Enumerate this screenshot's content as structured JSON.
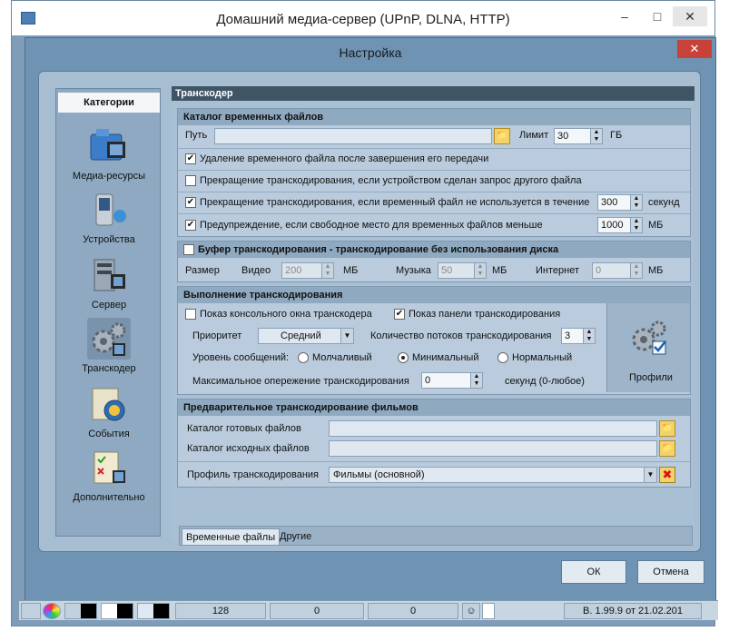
{
  "app": {
    "title": "Домашний медиа-сервер (UPnP, DLNA, HTTP)"
  },
  "dialog": {
    "title": "Настройка"
  },
  "sidebar": {
    "header": "Категории",
    "items": [
      {
        "label": "Медиа-ресурсы",
        "icon": "film-folder-icon"
      },
      {
        "label": "Устройства",
        "icon": "device-icon"
      },
      {
        "label": "Сервер",
        "icon": "server-icon"
      },
      {
        "label": "Транскодер",
        "icon": "gears-icon"
      },
      {
        "label": "События",
        "icon": "events-icon"
      },
      {
        "label": "Дополнительно",
        "icon": "checklist-icon"
      }
    ],
    "selected": "Транскодер"
  },
  "content": {
    "header": "Транскодер",
    "temp_catalog": {
      "title": "Каталог временных файлов",
      "path_label": "Путь",
      "path_value": "",
      "limit_label": "Лимит",
      "limit_value": "30",
      "limit_unit": "ГБ",
      "opt1": {
        "label": "Удаление временного файла после завершения его передачи",
        "checked": true
      },
      "opt2": {
        "label": "Прекращение транскодирования, если устройством сделан запрос другого файла",
        "checked": false
      },
      "opt3": {
        "label": "Прекращение транскодирования, если временный файл не используется в течение",
        "checked": true,
        "value": "300",
        "unit": "секунд"
      },
      "opt4": {
        "label": "Предупреждение, если свободное место для временных файлов меньше",
        "checked": true,
        "value": "1000",
        "unit": "МБ"
      }
    },
    "buffer": {
      "title": "Буфер транскодирования - транскодирование без использования диска",
      "checked": false,
      "size_label": "Размер",
      "video_label": "Видео",
      "video_value": "200",
      "video_unit": "МБ",
      "music_label": "Музыка",
      "music_value": "50",
      "music_unit": "МБ",
      "internet_label": "Интернет",
      "internet_value": "0",
      "internet_unit": "МБ"
    },
    "execution": {
      "title": "Выполнение транскодирования",
      "console_label": "Показ консольного окна транскодера",
      "console_checked": false,
      "panel_label": "Показ панели транскодирования",
      "panel_checked": true,
      "priority_label": "Приоритет",
      "priority_value": "Средний",
      "threads_label": "Количество потоков транскодирования",
      "threads_value": "3",
      "msg_level_label": "Уровень сообщений:",
      "levels": [
        "Молчаливый",
        "Минимальный",
        "Нормальный"
      ],
      "level_selected": "Минимальный",
      "max_ahead_label": "Максимальное опережение транскодирования",
      "max_ahead_value": "0",
      "max_ahead_unit": "секунд (0-любое)",
      "profiles_label": "Профили"
    },
    "pre_transcode": {
      "title": "Предварительное транскодирование фильмов",
      "ready_label": "Каталог готовых файлов",
      "ready_value": "",
      "source_label": "Каталог исходных файлов",
      "source_value": "",
      "profile_label": "Профиль транскодирования",
      "profile_value": "Фильмы (основной)"
    },
    "tabs": [
      "Временные файлы",
      "Другие"
    ]
  },
  "buttons": {
    "ok": "ОК",
    "cancel": "Отмена"
  },
  "statusbar": {
    "val1": "128",
    "val2": "0",
    "val3": "0",
    "version": "В. 1.99.9 от 21.02.201"
  }
}
